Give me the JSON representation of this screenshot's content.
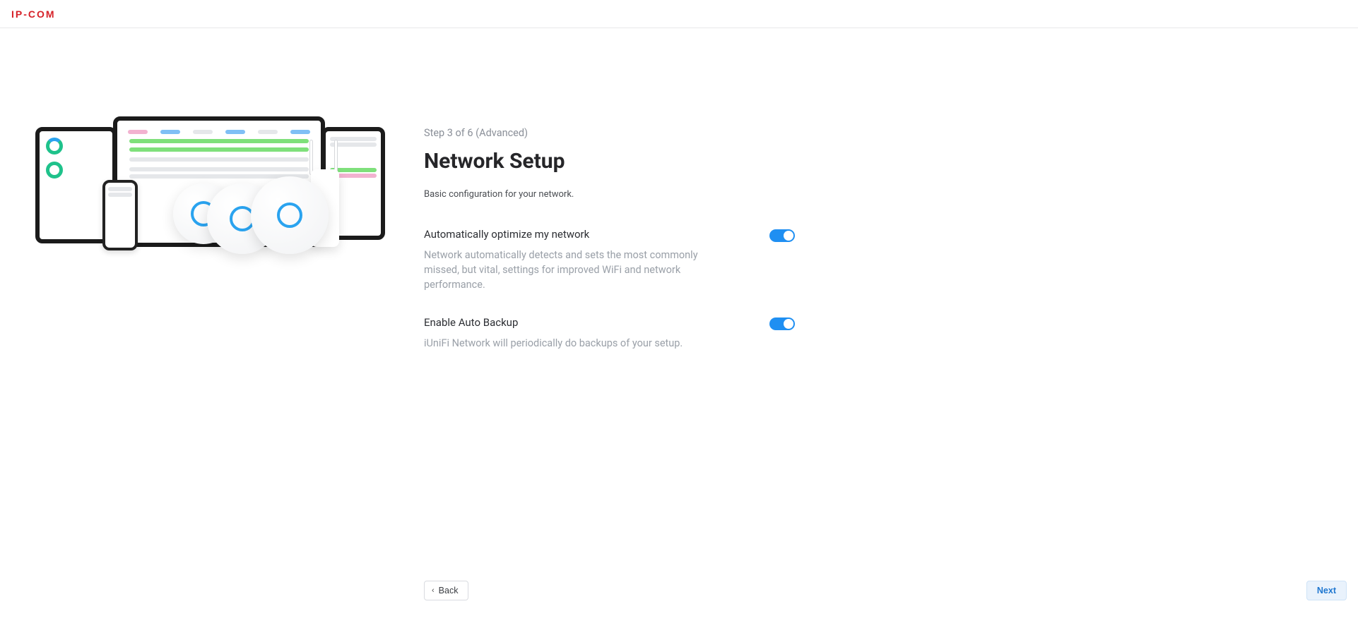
{
  "brand": {
    "logo_text": "IP-COM"
  },
  "wizard": {
    "step_label": "Step 3 of 6  (Advanced)",
    "title": "Network Setup",
    "subtitle": "Basic configuration for your network.",
    "options": {
      "optimize": {
        "label": "Automatically optimize my network",
        "description": "Network automatically detects and sets the most commonly missed, but vital, settings for improved WiFi and network performance.",
        "enabled": true
      },
      "backup": {
        "label": "Enable Auto Backup",
        "description": "iUniFi Network will periodically do backups of your setup.",
        "enabled": true
      }
    },
    "back_label": "Back",
    "next_label": "Next"
  },
  "colors": {
    "accent": "#1f8ff2",
    "brand": "#d62027"
  }
}
